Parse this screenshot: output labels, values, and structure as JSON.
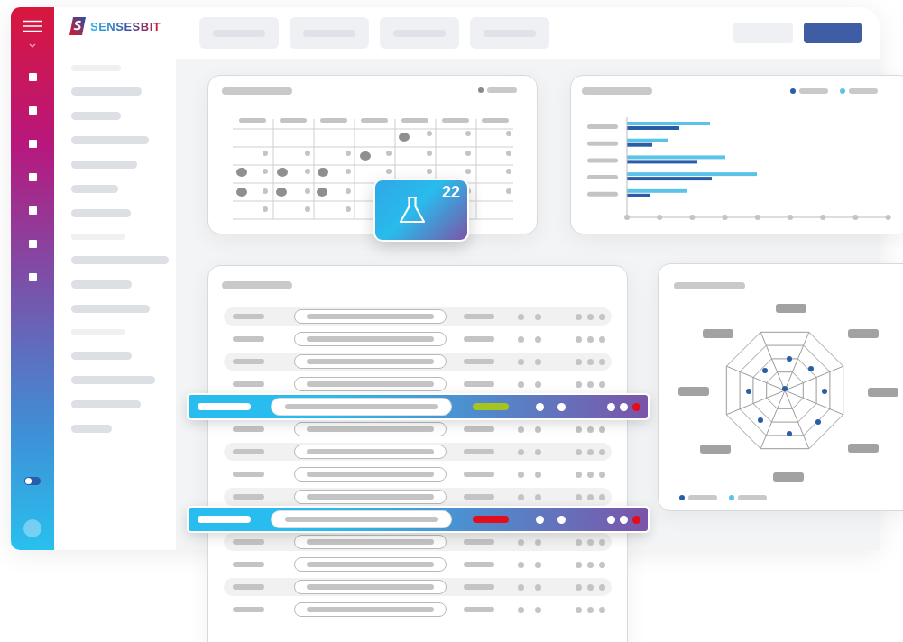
{
  "brand": {
    "name": "SENSESBIT"
  },
  "sidebar": {
    "theme_toggle": {
      "on": false
    }
  },
  "experiments_badge": {
    "count": "22"
  },
  "table": {
    "rows": [
      {
        "selected": false
      },
      {
        "selected": false
      },
      {
        "selected": false
      },
      {
        "selected": false
      },
      {
        "selected": true,
        "color": "#a5c41f"
      },
      {
        "selected": false
      },
      {
        "selected": false
      },
      {
        "selected": false
      },
      {
        "selected": false
      },
      {
        "selected": true,
        "color": "#e30d1b"
      },
      {
        "selected": false
      },
      {
        "selected": false
      },
      {
        "selected": false
      },
      {
        "selected": false
      }
    ]
  }
}
